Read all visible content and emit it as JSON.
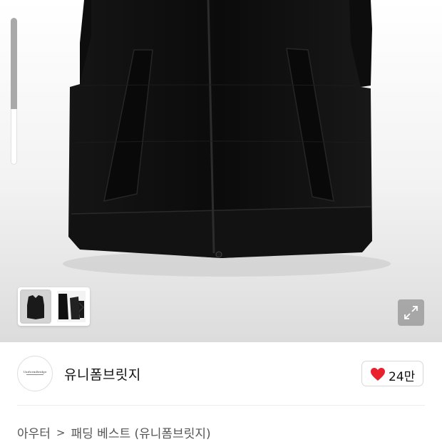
{
  "gallery": {
    "images": [
      {
        "alt": "black padded vest front"
      },
      {
        "alt": "black vest set"
      }
    ],
    "next_icon": "chevron-right-icon",
    "expand_icon": "expand-arrows-icon",
    "product_color": "#111111"
  },
  "brand": {
    "logo_text": "UniformBridge",
    "name": "유니폼브릿지"
  },
  "like": {
    "icon": "heart-icon",
    "count": "24만",
    "color": "#e8212c"
  },
  "breadcrumb": {
    "category": "아우터",
    "separator": ">",
    "product": "패딩 베스트 (유니폼브릿지)"
  }
}
